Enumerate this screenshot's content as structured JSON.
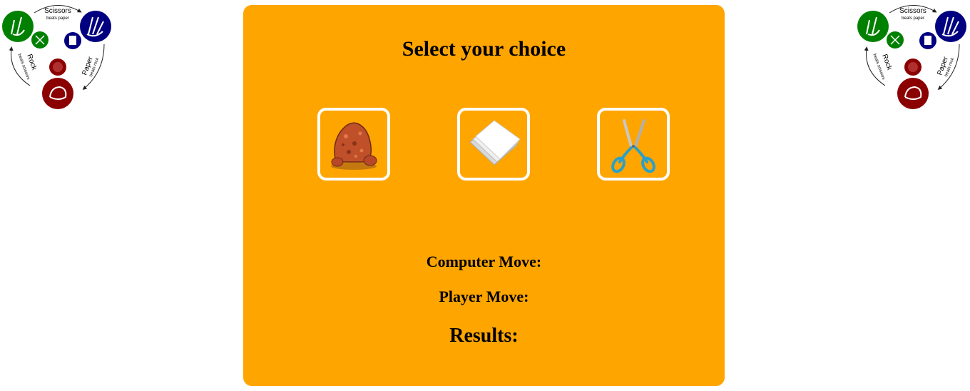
{
  "rules_diagram": {
    "scissors_label": "Scissors",
    "scissors_sub": "beats paper",
    "paper_label": "Paper",
    "paper_sub": "beats rock",
    "rock_label": "Rock",
    "rock_sub": "beats scissors",
    "colors": {
      "scissors": "#008000",
      "paper": "#000080",
      "rock": "#8b0000"
    }
  },
  "card": {
    "title": "Select your choice",
    "background": "#ffa500",
    "choices": [
      {
        "id": "rock",
        "icon": "rock-icon"
      },
      {
        "id": "paper",
        "icon": "paper-icon"
      },
      {
        "id": "scissors",
        "icon": "scissors-icon"
      }
    ],
    "computer_move_label": "Computer Move:",
    "player_move_label": "Player Move:",
    "results_label": "Results:"
  }
}
